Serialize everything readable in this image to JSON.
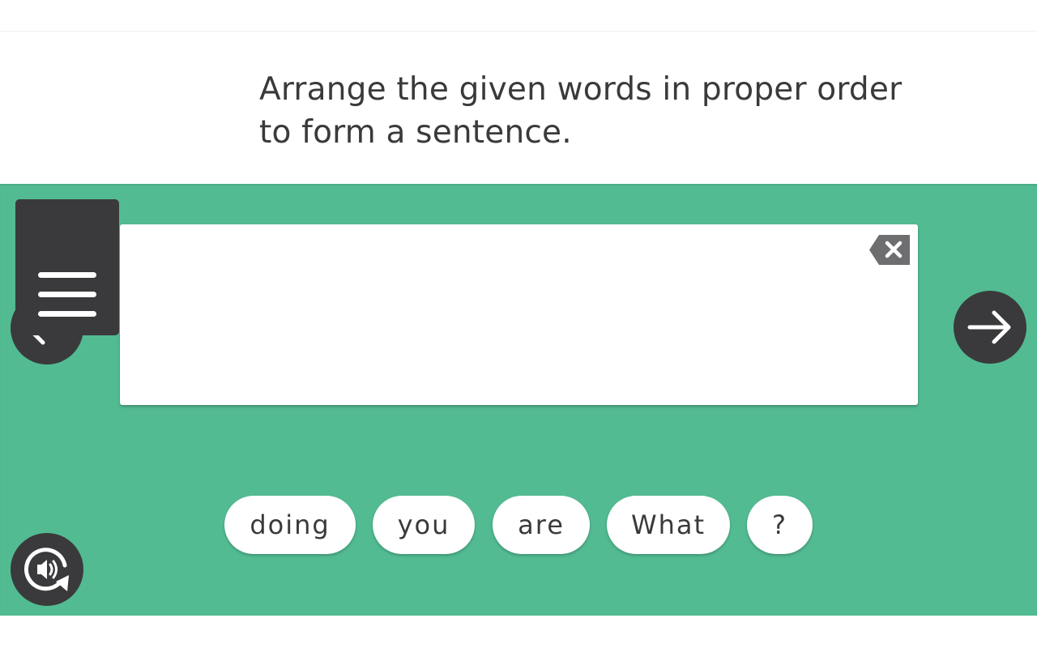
{
  "instruction": {
    "text": "Arrange the given words in proper order to form a sentence."
  },
  "answer": {
    "value": ""
  },
  "word_bank": [
    {
      "label": "doing"
    },
    {
      "label": "you"
    },
    {
      "label": "are"
    },
    {
      "label": "What"
    },
    {
      "label": "?"
    }
  ],
  "icons": {
    "menu": "hamburger-menu-icon",
    "previous": "arrow-left-icon",
    "next": "arrow-right-icon",
    "clear": "backspace-icon",
    "audio": "replay-audio-icon"
  },
  "colors": {
    "stage_background": "#52bb92",
    "dark_button": "#3a3a3c",
    "backspace_icon": "#6e6e70",
    "text": "#3a3a3c",
    "chip_background": "#ffffff"
  }
}
